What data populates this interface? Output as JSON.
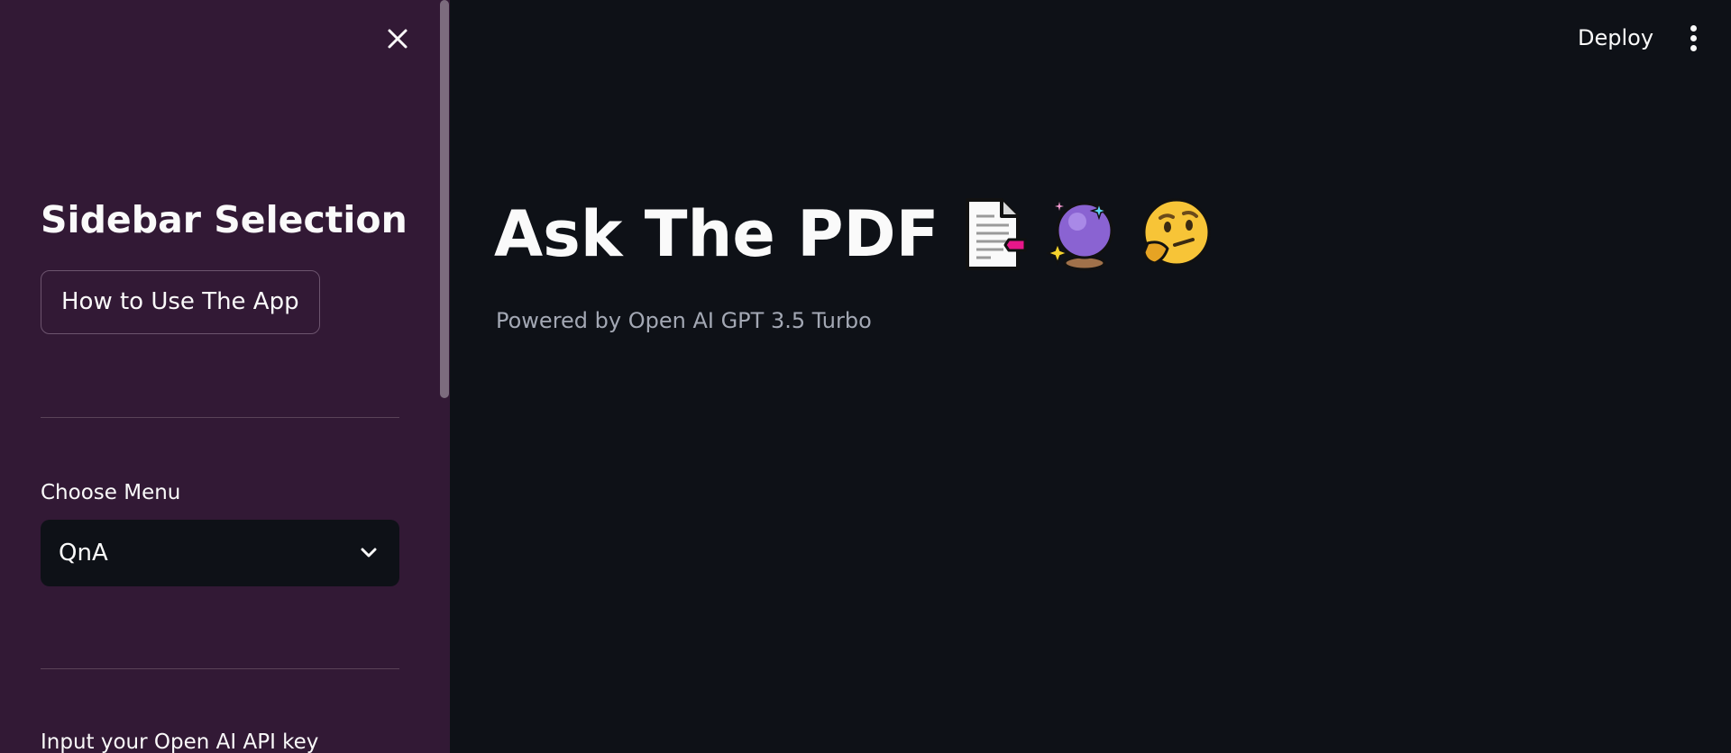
{
  "sidebar": {
    "title": "Sidebar Selection",
    "howto_button_label": "How to Use The App",
    "menu": {
      "label": "Choose Menu",
      "selected_value": "QnA"
    },
    "apikey_label": "Input your Open AI API key"
  },
  "header": {
    "deploy_label": "Deploy"
  },
  "main": {
    "title": "Ask The PDF",
    "title_icons": [
      "page-facing-up-icon",
      "crystal-ball-icon",
      "thinking-face-icon"
    ],
    "subtitle": "Powered by Open AI GPT 3.5 Turbo"
  },
  "colors": {
    "sidebar_background": "#321935",
    "main_background": "#0e1117",
    "text_primary": "#fafafa",
    "text_secondary": "#a3a8b4"
  }
}
